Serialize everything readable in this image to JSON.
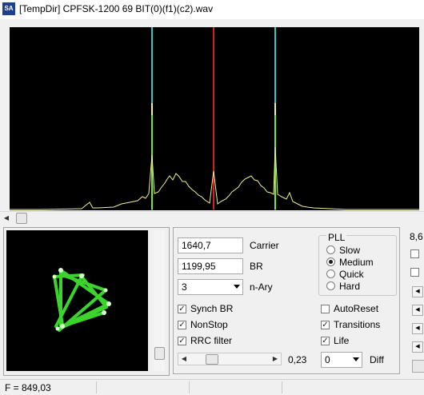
{
  "window": {
    "title": "[TempDir] CPFSK-1200 69 BIT(0)(f1)(c2).wav",
    "icon_text": "SA"
  },
  "spectrum": {
    "trace_color": "#f0f090",
    "center_marker_color": "#d02020",
    "side_marker_color": "#40c0c0",
    "peak_color": "#7fe040"
  },
  "controls": {
    "carrier": {
      "value": "1640,7",
      "label": "Carrier"
    },
    "br": {
      "value": "1199,95",
      "label": "BR"
    },
    "nary": {
      "value": "3",
      "label": "n-Ary"
    },
    "checkboxes": [
      {
        "label": "Synch BR",
        "checked": true
      },
      {
        "label": "NonStop",
        "checked": true
      },
      {
        "label": "RRC filter",
        "checked": true
      },
      {
        "label": "AutoReset",
        "checked": false
      },
      {
        "label": "Transitions",
        "checked": true
      },
      {
        "label": "Life",
        "checked": true
      }
    ],
    "pll": {
      "title": "PLL",
      "options": [
        "Slow",
        "Medium",
        "Quick",
        "Hard"
      ],
      "selected": "Medium"
    },
    "rrc_slider": {
      "value_label": "0,23"
    },
    "diff": {
      "value": "0",
      "label": "Diff"
    },
    "right_partial_label": "8,6"
  },
  "status": {
    "text": "F = 849,03"
  }
}
